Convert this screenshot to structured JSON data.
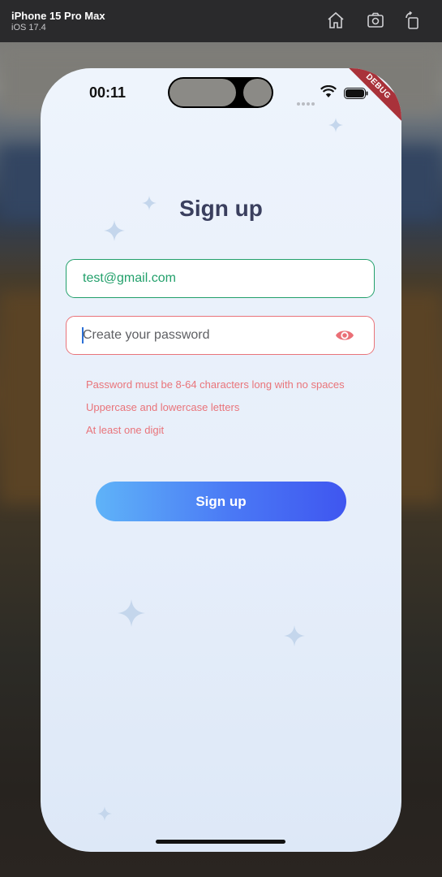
{
  "simulator": {
    "device": "iPhone 15 Pro Max",
    "os": "iOS 17.4",
    "icons": [
      "home-icon",
      "screenshot-icon",
      "rotate-icon"
    ]
  },
  "status_bar": {
    "time": "00:11",
    "debug_label": "DEBUG"
  },
  "screen": {
    "title": "Sign up",
    "email": {
      "value": "test@gmail.com"
    },
    "password": {
      "placeholder": "Create your password"
    },
    "hints": [
      "Password must be 8-64 characters long with no spaces",
      "Uppercase and lowercase letters",
      "At least one digit"
    ],
    "submit_label": "Sign up"
  },
  "colors": {
    "valid": "#22a06b",
    "error": "#e9747a",
    "title": "#3a3f5e",
    "button_start": "#5fb3f8",
    "button_end": "#3f56f0"
  }
}
